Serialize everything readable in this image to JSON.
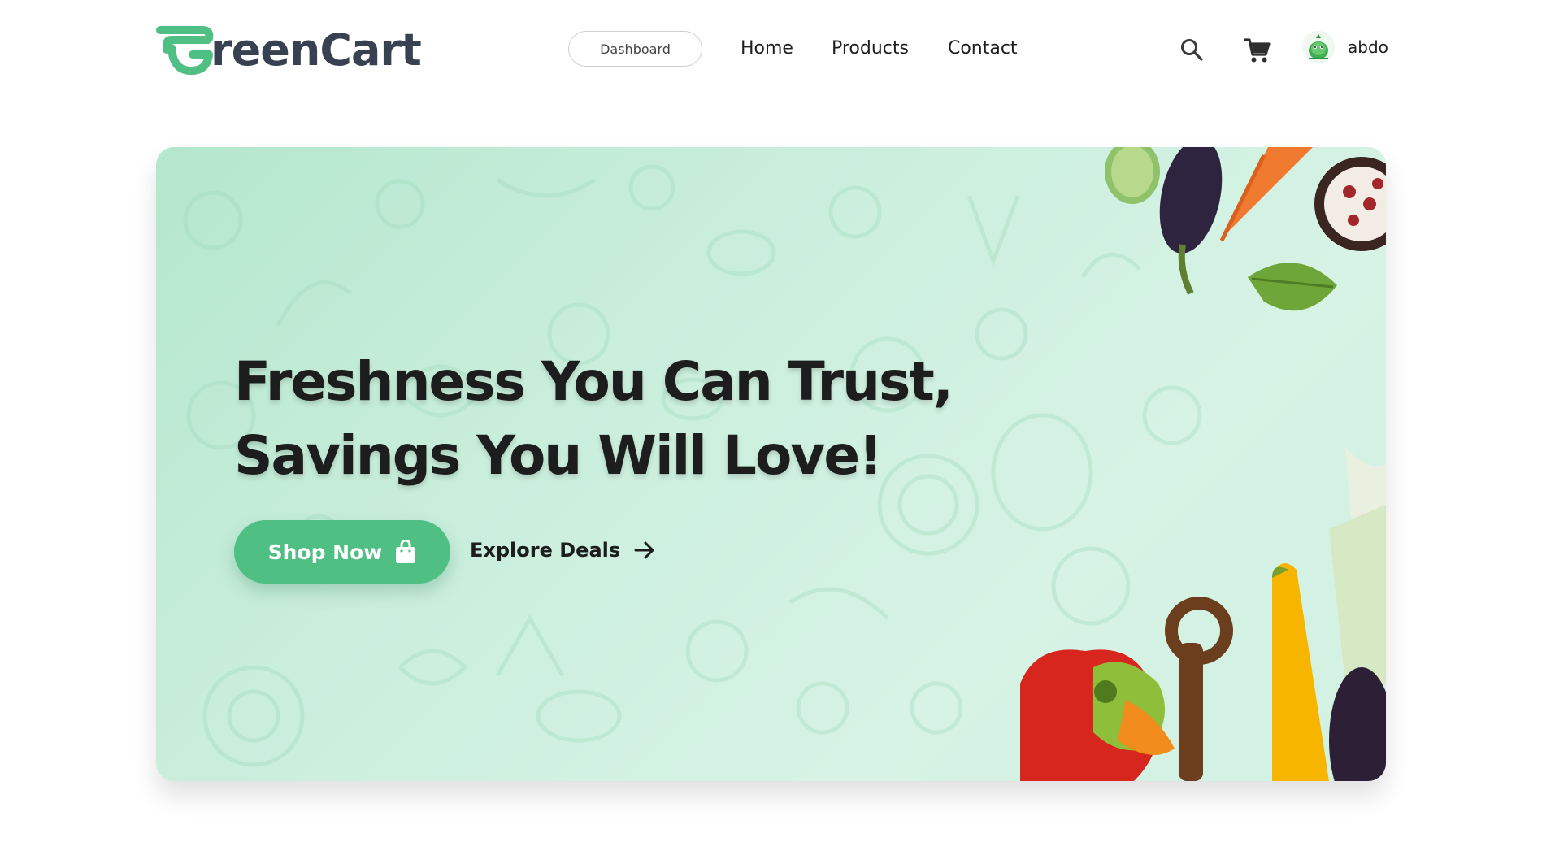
{
  "brand": {
    "name": "GreenCart",
    "text_after_mark": "reenCart",
    "accent_color": "#4fbf83",
    "dark_text_color": "#374151"
  },
  "navbar": {
    "dashboard_label": "Dashboard",
    "links": [
      "Home",
      "Products",
      "Contact"
    ],
    "search_icon": "search-icon",
    "cart_icon": "cart-icon",
    "user": {
      "name": "abdo",
      "avatar_icon": "avatar-image"
    }
  },
  "hero": {
    "title_line1": "Freshness You Can Trust,",
    "title_line2": "Savings You Will Love!",
    "primary_cta": "Shop Now",
    "primary_cta_icon": "shopping-bag-icon",
    "secondary_cta": "Explore Deals",
    "secondary_cta_icon": "arrow-right-icon",
    "background_color": "#c9eedc"
  }
}
